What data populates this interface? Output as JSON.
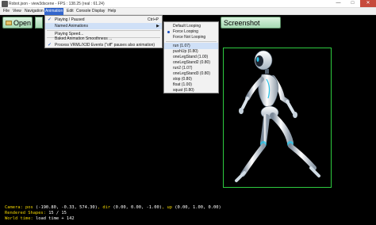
{
  "window": {
    "title": "Robot.json - view3dscene - FPS : 138.25 (real : 61.24)",
    "min_glyph": "—",
    "max_glyph": "□",
    "close_glyph": "✕"
  },
  "menubar": {
    "items": [
      "File",
      "View",
      "Navigation",
      "Animation",
      "Edit",
      "Console",
      "Display",
      "Help"
    ]
  },
  "toolbar": {
    "open_label": "Open",
    "screenshot_label": "Screenshot"
  },
  "animation_menu": {
    "items": [
      {
        "label": "Playing / Paused",
        "shortcut": "Ctrl+P",
        "checked": true
      },
      {
        "label": "Named Animations",
        "submenu": true
      },
      {
        "label": "Playing Speed..."
      },
      {
        "label": "Baked Animation Smoothness ..."
      },
      {
        "label": "Process VRML/X3D Events (\"off\" pauses also animation)",
        "checked": true
      }
    ]
  },
  "named_animations": {
    "items": [
      {
        "label": "Default Looping"
      },
      {
        "label": "Force Looping",
        "selected": true
      },
      {
        "label": "Force Not Looping"
      },
      {
        "label": "run (1.07)",
        "highlighted": true
      },
      {
        "label": "pushUp (0.80)"
      },
      {
        "label": "oneLegStand (1.00)"
      },
      {
        "label": "oneLegStand2 (0.80)"
      },
      {
        "label": "run2 (1.07)"
      },
      {
        "label": "oneLegStand3 (0.80)"
      },
      {
        "label": "stop (0.80)"
      },
      {
        "label": "float (1.00)"
      },
      {
        "label": "squat (0.80)"
      }
    ]
  },
  "status": {
    "camera_label": "Camera: pos",
    "camera_pos": "(-190.80, -0.33, 574.30)",
    "dir_label": "dir",
    "camera_dir": "(0.00, 0.00, -1.00)",
    "up_label": "up",
    "camera_up": "(0.00, 1.00, 0.00)",
    "rendered_label": "Rendered Shapes:",
    "rendered_value": "15 / 15",
    "world_label": "World time:",
    "world_value": "load time + 142"
  },
  "colors": {
    "status_label": "#f2d500",
    "bbox": "#2ecc40",
    "menu_highlight": "#3366cc"
  }
}
